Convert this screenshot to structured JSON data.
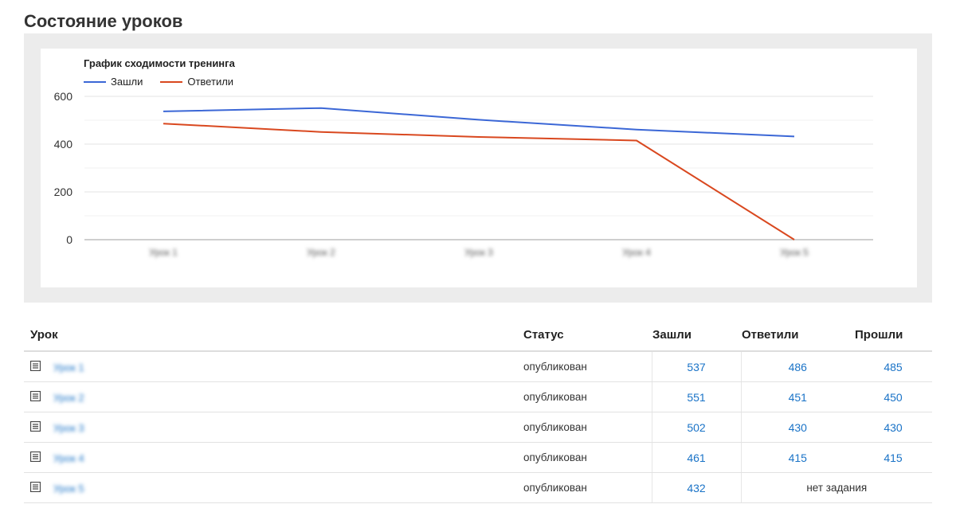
{
  "page": {
    "title": "Состояние уроков"
  },
  "chart_data": {
    "type": "line",
    "title": "График сходимости тренинга",
    "categories": [
      "Урок 1",
      "Урок 2",
      "Урок 3",
      "Урок 4",
      "Урок 5"
    ],
    "series": [
      {
        "name": "Зашли",
        "color": "#3b67d6",
        "values": [
          537,
          551,
          502,
          461,
          432
        ]
      },
      {
        "name": "Ответили",
        "color": "#d9481f",
        "values": [
          486,
          451,
          430,
          415,
          0
        ]
      }
    ],
    "yticks": [
      0,
      200,
      400,
      600
    ],
    "ylim": [
      0,
      600
    ],
    "grid": true,
    "legend_position": "top-left"
  },
  "table": {
    "headers": {
      "lesson": "Урок",
      "status": "Статус",
      "entered": "Зашли",
      "answered": "Ответили",
      "passed": "Прошли"
    },
    "rows": [
      {
        "lesson": "Урок 1",
        "status": "опубликован",
        "entered": "537",
        "answered": "486",
        "passed": "485",
        "has_task": true
      },
      {
        "lesson": "Урок 2",
        "status": "опубликован",
        "entered": "551",
        "answered": "451",
        "passed": "450",
        "has_task": true
      },
      {
        "lesson": "Урок 3",
        "status": "опубликован",
        "entered": "502",
        "answered": "430",
        "passed": "430",
        "has_task": true
      },
      {
        "lesson": "Урок 4",
        "status": "опубликован",
        "entered": "461",
        "answered": "415",
        "passed": "415",
        "has_task": true
      },
      {
        "lesson": "Урок 5",
        "status": "опубликован",
        "entered": "432",
        "no_task_text": "нет задания",
        "has_task": false
      }
    ]
  }
}
